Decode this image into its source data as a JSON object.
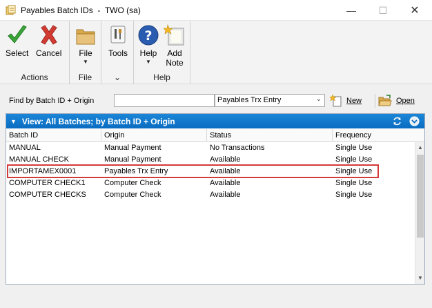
{
  "window": {
    "title": "Payables Batch IDs  -  TWO (sa)",
    "min_glyph": "—",
    "max_glyph": "☐",
    "close_glyph": "✕"
  },
  "ribbon": {
    "groups": [
      {
        "label": "Actions",
        "buttons": [
          {
            "label": "Select",
            "icon": "checkmark-icon"
          },
          {
            "label": "Cancel",
            "icon": "x-icon"
          }
        ]
      },
      {
        "label": "File",
        "buttons": [
          {
            "label": "File",
            "icon": "folder-icon"
          }
        ]
      },
      {
        "label": "",
        "buttons": [
          {
            "label": "Tools",
            "icon": "tools-icon"
          }
        ]
      },
      {
        "label": "Help",
        "buttons": [
          {
            "label": "Help",
            "icon": "help-icon"
          },
          {
            "label": "Add\nNote",
            "icon": "note-icon"
          }
        ]
      }
    ],
    "caret": "▼",
    "small_caret": "⌄"
  },
  "find": {
    "label": "Find by Batch ID + Origin",
    "value": "",
    "select_value": "Payables Trx Entry",
    "new_label": "New",
    "open_label": "Open"
  },
  "view": {
    "title": "View: All Batches; by Batch ID + Origin",
    "columns": [
      "Batch ID",
      "Origin",
      "Status",
      "Frequency"
    ],
    "rows": [
      [
        "MANUAL",
        "Manual Payment",
        "No Transactions",
        "Single Use"
      ],
      [
        "MANUAL CHECK",
        "Manual Payment",
        "Available",
        "Single Use"
      ],
      [
        "IMPORTAMEX0001",
        "Payables Trx Entry",
        "Available",
        "Single Use"
      ],
      [
        "COMPUTER CHECK1",
        "Computer Check",
        "Available",
        "Single Use"
      ],
      [
        "COMPUTER CHECKS",
        "Computer Check",
        "Available",
        "Single Use"
      ]
    ]
  },
  "colors": {
    "header_blue": "#0a6cc0",
    "highlight_red": "#d33a3a",
    "check_green": "#3aa53a",
    "cancel_red": "#d23b32",
    "help_blue": "#2a5db0"
  }
}
